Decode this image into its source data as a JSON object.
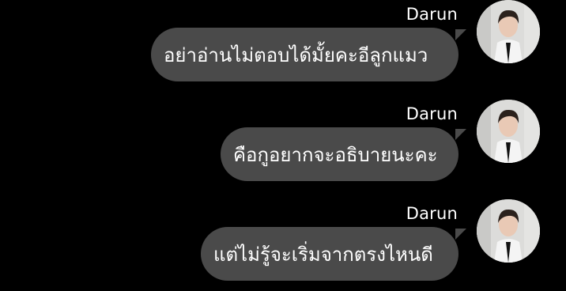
{
  "messages": [
    {
      "sender": "Darun",
      "text": "อย่าอ่านไม่ตอบได้มั้ยคะอีลูกแมว"
    },
    {
      "sender": "Darun",
      "text": "คือกูอยากจะอธิบายนะคะ"
    },
    {
      "sender": "Darun",
      "text": "แต่ไม่รู้จะเริ่มจากตรงไหนดี"
    }
  ],
  "colors": {
    "background": "#000000",
    "bubble": "#4a4a4a",
    "text": "#ffffff"
  },
  "icons": {
    "avatar": "profile-photo"
  }
}
